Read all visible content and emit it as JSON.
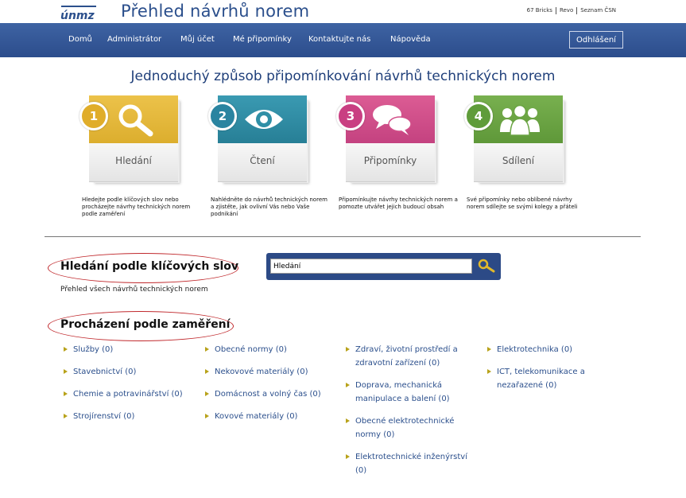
{
  "header": {
    "logo_text": "únmz",
    "title": "Přehled návrhů norem",
    "top_links": [
      "67 Bricks",
      "Revo",
      "Seznam ČSN"
    ]
  },
  "nav": {
    "items": [
      "Domů",
      "Administrátor",
      "Můj účet",
      "Mé připomínky",
      "Kontaktujte nás",
      "Nápověda"
    ],
    "login_label": "Odhlášení"
  },
  "hero": {
    "title": "Jednoduchý způsob připomínkování návrhů technických norem",
    "steps": [
      {
        "number": "1",
        "label": "Hledání",
        "color": "#e6b836",
        "icon": "magnifier-icon",
        "description": "Hledejte podle klíčových slov nebo procházejte návrhy technických norem podle zaměření"
      },
      {
        "number": "2",
        "label": "Čtení",
        "color": "#2f8fa6",
        "icon": "eye-icon",
        "description": "Nahlédněte do návrhů technických norem a zjistěte, jak ovlivní Vás nebo Vaše podnikání"
      },
      {
        "number": "3",
        "label": "Připomínky",
        "color": "#d2508a",
        "icon": "speech-bubbles-icon",
        "description": "Připomínkujte návrhy technických norem a pomozte utvářet jejich budoucí obsah"
      },
      {
        "number": "4",
        "label": "Sdílení",
        "color": "#6aa443",
        "icon": "people-icon",
        "description": "Své připomínky nebo oblíbené návrhy norem sdílejte se svými kolegy a přáteli"
      }
    ]
  },
  "search": {
    "title": "Hledání podle klíčových slov",
    "sub_link": "Přehled všech návrhů technických norem",
    "value": "Hledání",
    "icon": "search-key-icon"
  },
  "browse": {
    "title": "Procházení podle zaměření",
    "columns": [
      [
        "Služby (0)",
        "Stavebnictví (0)",
        "Chemie a potravinářství (0)",
        "Strojírenství (0)"
      ],
      [
        "Obecné normy (0)",
        "Nekovové materiály (0)",
        "Domácnost a volný čas (0)",
        "Kovové materiály (0)"
      ],
      [
        "Zdraví, životní prostředí a zdravotní zařízení (0)",
        "Doprava, mechanická manipulace a balení (0)",
        "Obecné elektrotechnické normy (0)",
        "Elektrotechnické inženýrství (0)"
      ],
      [
        "Elektrotechnika (0)",
        "ICT, telekomunikace a nezařazené (0)"
      ]
    ]
  },
  "colors": {
    "accent_blue": "#2b4f8c",
    "nav_blue": "#34589a",
    "highlight_red": "#c0282c",
    "bullet": "#b8a21a"
  }
}
